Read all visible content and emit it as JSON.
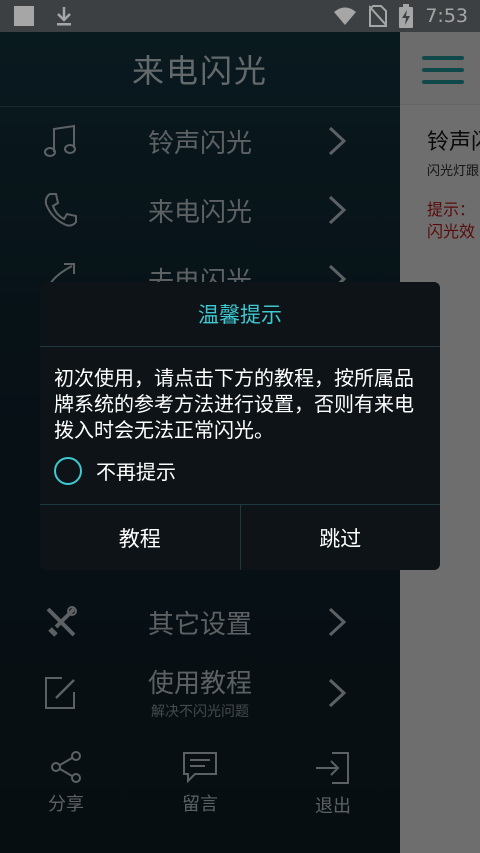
{
  "status_bar": {
    "time": "7:53"
  },
  "drawer": {
    "title": "来电闪光",
    "items": [
      {
        "label": "铃声闪光",
        "icon": "music-note-icon"
      },
      {
        "label": "来电闪光",
        "icon": "phone-icon"
      },
      {
        "label": "去电闪光",
        "icon": "outgoing-call-icon"
      },
      {
        "label": "其它设置",
        "icon": "tools-icon"
      },
      {
        "label": "使用教程",
        "sub": "解决不闪光问题",
        "icon": "edit-icon"
      }
    ],
    "bottom": [
      {
        "label": "分享",
        "icon": "share-icon"
      },
      {
        "label": "留言",
        "icon": "message-icon"
      },
      {
        "label": "退出",
        "icon": "exit-icon"
      }
    ]
  },
  "content": {
    "title": "铃声闪光",
    "subtitle": "闪光灯跟",
    "tip_line1": "提示：",
    "tip_line2": "闪光效"
  },
  "dialog": {
    "title": "温馨提示",
    "message": "初次使用，请点击下方的教程，按所属品牌系统的参考方法进行设置，否则有来电拨入时会无法正常闪光。",
    "checkbox_label": "不再提示",
    "button_left": "教程",
    "button_right": "跳过"
  },
  "colors": {
    "accent": "#3ec8d2",
    "drawer_bg": "#0f2830",
    "tip_red": "#8a1010"
  }
}
